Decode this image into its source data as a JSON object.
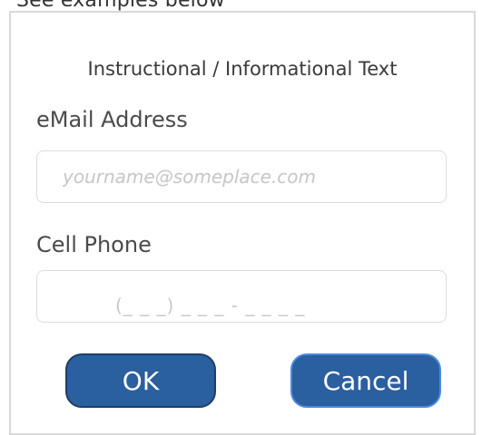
{
  "page": {
    "cropped_header_text": "See examples below"
  },
  "dialog": {
    "info_text": "Instructional / Informational Text",
    "email": {
      "label": "eMail Address",
      "placeholder": "yourname@someplace.com",
      "value": ""
    },
    "phone": {
      "label": "Cell Phone",
      "mask": "(_ _ _) _ _ _ - _ _ _ _",
      "value": ""
    },
    "buttons": {
      "ok": "OK",
      "cancel": "Cancel"
    },
    "colors": {
      "button_bg": "#2a5fa0",
      "border": "#d9d9d9"
    }
  }
}
